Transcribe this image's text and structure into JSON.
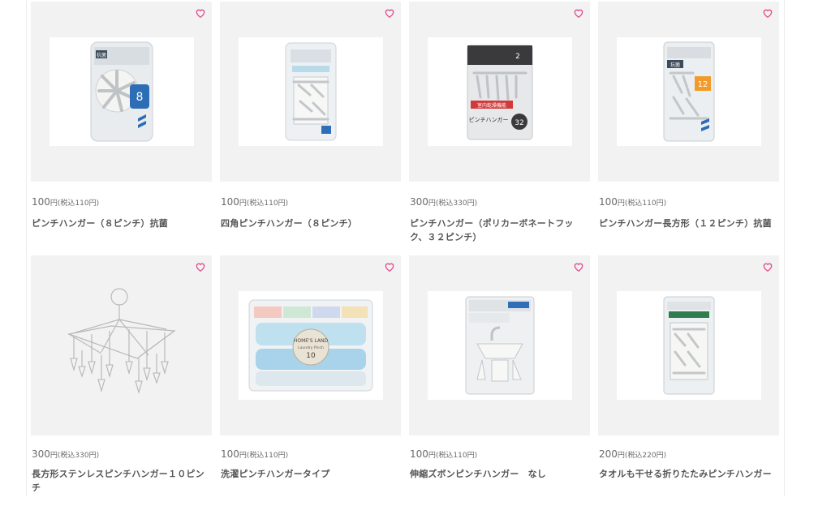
{
  "colors": {
    "heart": "#e0498a",
    "thumb_bg": "#f2f2f2"
  },
  "products": [
    {
      "price": "100",
      "yen": "円",
      "tax": "(税込110円)",
      "name": "ピンチハンガー（８ピンチ）抗菌",
      "icon": "heart-icon"
    },
    {
      "price": "100",
      "yen": "円",
      "tax": "(税込110円)",
      "name": "四角ピンチハンガー（８ピンチ）",
      "icon": "heart-icon"
    },
    {
      "price": "300",
      "yen": "円",
      "tax": "(税込330円)",
      "name": "ピンチハンガー（ポリカーボネートフック、３２ピンチ）",
      "icon": "heart-icon"
    },
    {
      "price": "100",
      "yen": "円",
      "tax": "(税込110円)",
      "name": "ピンチハンガー長方形（１２ピンチ）抗菌",
      "icon": "heart-icon"
    },
    {
      "price": "300",
      "yen": "円",
      "tax": "(税込330円)",
      "name": "長方形ステンレスピンチハンガー１０ピンチ",
      "icon": "heart-icon"
    },
    {
      "price": "100",
      "yen": "円",
      "tax": "(税込110円)",
      "name": "洗濯ピンチハンガータイプ",
      "icon": "heart-icon"
    },
    {
      "price": "100",
      "yen": "円",
      "tax": "(税込110円)",
      "name": "伸縮ズボンピンチハンガー　なし",
      "icon": "heart-icon"
    },
    {
      "price": "200",
      "yen": "円",
      "tax": "(税込220円)",
      "name": "タオルも干せる折りたたみピンチハンガー",
      "icon": "heart-icon"
    }
  ],
  "package_labels": {
    "p1_badge": "抗菌",
    "p1_count": "8",
    "p3_band": "室内乾燥機能",
    "p3_count": "32",
    "p3_label": "ピンチハンガー",
    "p4_badge": "抗菌",
    "p4_count": "12",
    "p6_brand": "HOME'S LAND",
    "p6_sub": "Laundry Pinch",
    "p6_count": "10"
  }
}
